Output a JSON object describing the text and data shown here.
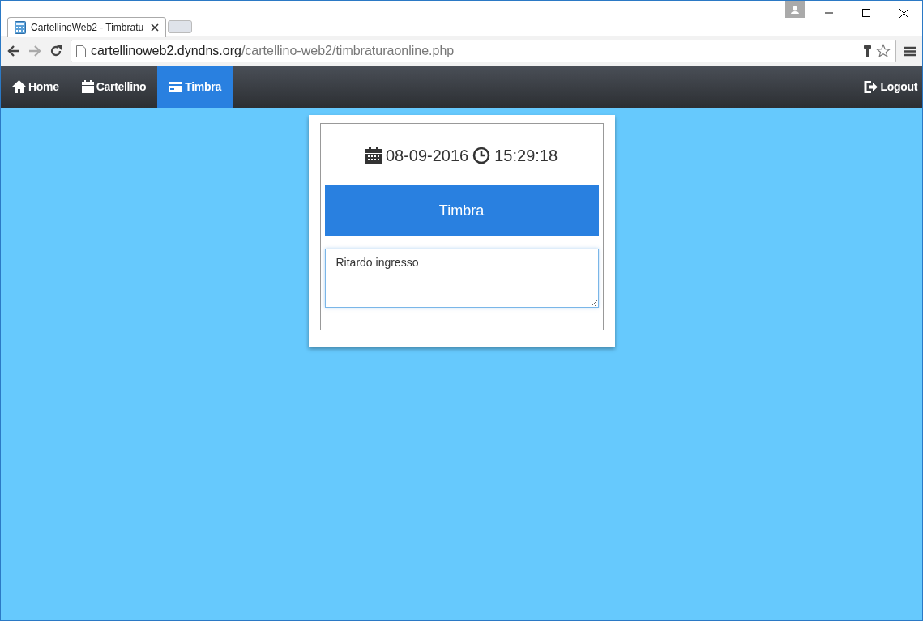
{
  "browser": {
    "tab_title": "CartellinoWeb2 - Timbratu",
    "url_host": "cartellinoweb2.dyndns.org",
    "url_path": "/cartellino-web2/timbraturaonline.php"
  },
  "navbar": {
    "items": [
      {
        "label": "Home",
        "selected": false
      },
      {
        "label": "Cartellino",
        "selected": false
      },
      {
        "label": "Timbra",
        "selected": true
      }
    ],
    "logout": "Logout"
  },
  "panel": {
    "date": "08-09-2016",
    "time": "15:29:18",
    "button": "Timbra",
    "note_value": "Ritardo ingresso"
  }
}
